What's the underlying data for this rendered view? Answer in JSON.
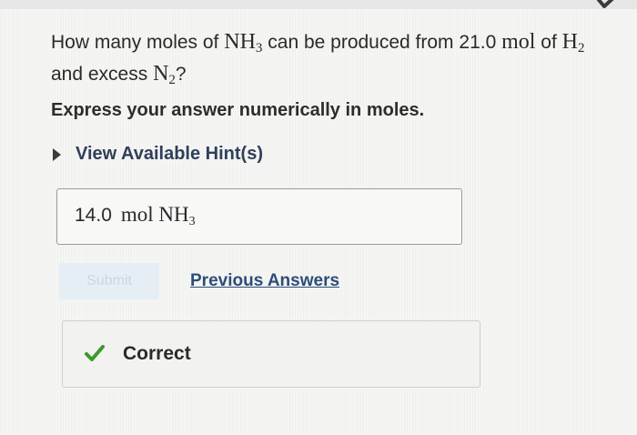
{
  "question": {
    "prefix": "How many moles of",
    "product": "NH",
    "product_sub": "3",
    "middle": "can be produced from 21.0",
    "unit": "mol",
    "of_word": "of",
    "reactant": "H",
    "reactant_sub": "2",
    "line2_prefix": "and excess",
    "excess": "N",
    "excess_sub": "2",
    "line2_suffix": "?"
  },
  "instruction": "Express your answer numerically in moles.",
  "hint": {
    "label": "View Available Hint(s)"
  },
  "answer": {
    "number": "14.0",
    "unit": "mol NH",
    "unit_sub": "3"
  },
  "actions": {
    "submit_label": "Submit",
    "previous_answers_label": "Previous Answers"
  },
  "feedback": {
    "status": "Correct"
  },
  "colors": {
    "check_green": "#3a9a2b",
    "link_blue": "#2d4d7a",
    "submit_disabled_bg": "#e5eef5"
  }
}
